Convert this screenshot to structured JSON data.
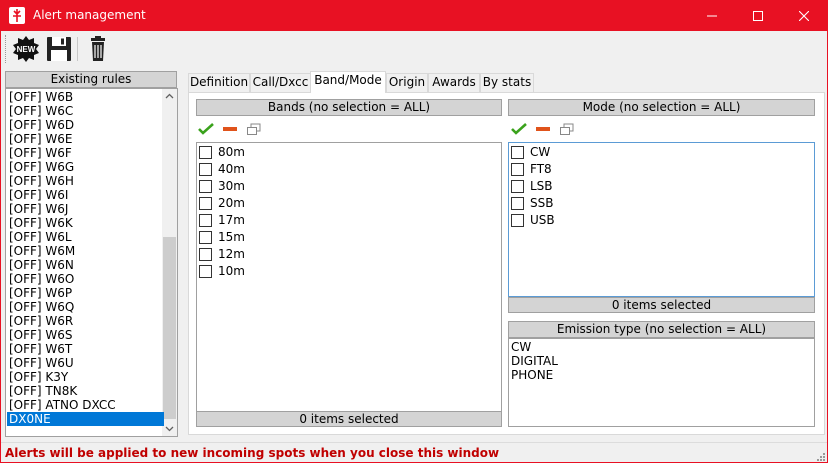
{
  "window": {
    "title": "Alert management",
    "accent_color": "#e81123"
  },
  "toolbar": {
    "buttons": [
      {
        "name": "new-icon",
        "label": "NEW"
      },
      {
        "name": "save-icon"
      },
      {
        "name": "trash-icon"
      }
    ]
  },
  "rules": {
    "header": "Existing rules",
    "items": [
      "[OFF] W6B",
      "[OFF] W6C",
      "[OFF] W6D",
      "[OFF] W6E",
      "[OFF] W6F",
      "[OFF] W6G",
      "[OFF] W6H",
      "[OFF] W6I",
      "[OFF] W6J",
      "[OFF] W6K",
      "[OFF] W6L",
      "[OFF] W6M",
      "[OFF] W6N",
      "[OFF] W6O",
      "[OFF] W6P",
      "[OFF] W6Q",
      "[OFF] W6R",
      "[OFF] W6S",
      "[OFF] W6T",
      "[OFF] W6U",
      "[OFF] K3Y",
      "[OFF] TN8K",
      "[OFF] ATNO DXCC",
      "DX0NE"
    ],
    "selected": "DX0NE",
    "selection_color": "#0078d7"
  },
  "tabs": [
    {
      "label": "Definition",
      "active": false
    },
    {
      "label": "Call/Dxcc",
      "active": false
    },
    {
      "label": "Band/Mode",
      "active": true
    },
    {
      "label": "Origin",
      "active": false
    },
    {
      "label": "Awards",
      "active": false
    },
    {
      "label": "By stats",
      "active": false
    }
  ],
  "bands": {
    "header": "Bands (no selection = ALL)",
    "items": [
      "80m",
      "40m",
      "30m",
      "20m",
      "17m",
      "15m",
      "12m",
      "10m"
    ],
    "footer": "0 items selected"
  },
  "mode": {
    "header": "Mode (no selection = ALL)",
    "items": [
      "CW",
      "FT8",
      "LSB",
      "SSB",
      "USB"
    ],
    "footer": "0 items selected"
  },
  "emission": {
    "header": "Emission type (no selection = ALL)",
    "items": [
      "CW",
      "DIGITAL",
      "PHONE"
    ]
  },
  "mini_tools": [
    "check-all-icon",
    "clear-icon",
    "restore-icon"
  ],
  "status": {
    "message": "Alerts will be applied to new incoming spots when you close this window",
    "color": "#c00000"
  }
}
